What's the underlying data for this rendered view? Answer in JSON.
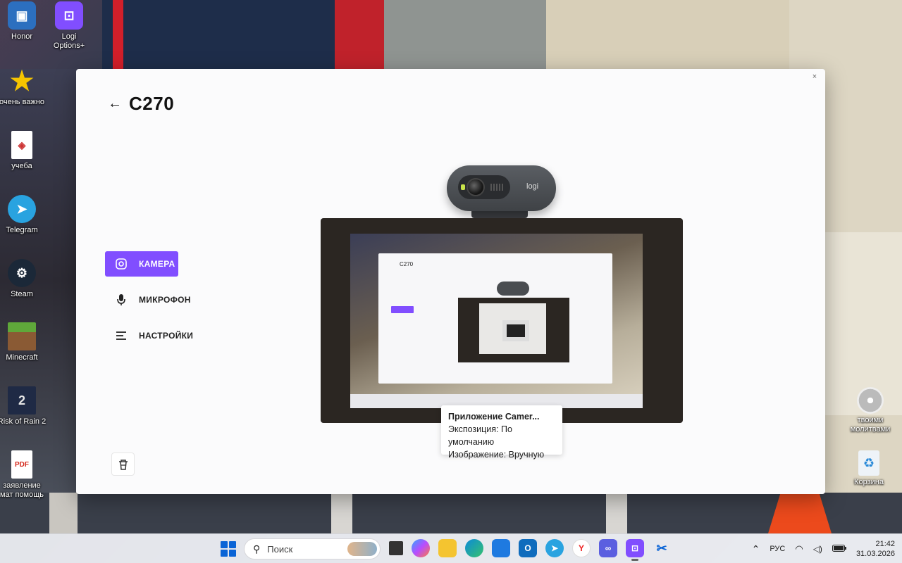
{
  "desktop": {
    "icons": [
      {
        "label": "Honor"
      },
      {
        "label": "Logi Options+"
      },
      {
        "label": "очень важно"
      },
      {
        "label": "учеба"
      },
      {
        "label": "Telegram"
      },
      {
        "label": "Steam"
      },
      {
        "label": "Minecraft"
      },
      {
        "label": "Risk of Rain 2"
      },
      {
        "label": "заявление мат помощь"
      }
    ],
    "right_icons": [
      {
        "label": "твоими молитвами"
      },
      {
        "label": "Корзина"
      }
    ]
  },
  "window": {
    "close": "×",
    "back": "←",
    "device_title": "C270",
    "nav": [
      {
        "label": "КАМЕРА",
        "icon": "camera-icon"
      },
      {
        "label": "МИКРОФОН",
        "icon": "microphone-icon"
      },
      {
        "label": "НАСТРОЙКИ",
        "icon": "settings-icon"
      }
    ],
    "webcam_brand": "logi",
    "preview_title": "C270",
    "tooltip": {
      "title": "Приложение Camer...",
      "line1": "Экспозиция: По умолчанию",
      "line2": "Изображение: Вручную"
    }
  },
  "taskbar": {
    "search_placeholder": "Поиск",
    "language": "РУС",
    "time": "21:42",
    "date": "31.03.2026"
  },
  "colors": {
    "accent": "#814eff",
    "windows_blue": "#0a64d6"
  }
}
